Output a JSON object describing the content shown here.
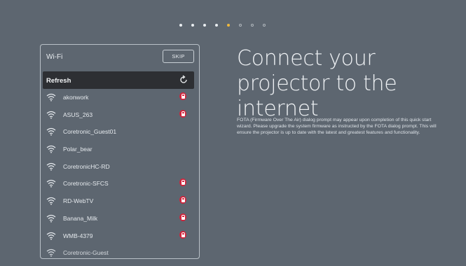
{
  "progress": {
    "total_steps": 8,
    "current_step": 5
  },
  "colors": {
    "background": "#5d6670",
    "active_step": "#f0b83b",
    "lock": "#d0243c",
    "refresh_bar": "#2d2f33"
  },
  "wifi_panel": {
    "title": "Wi-Fi",
    "skip_label": "SKIP",
    "refresh_label": "Refresh",
    "refresh_icon": "refresh-icon",
    "networks": [
      {
        "name": "akonwork",
        "secured": true
      },
      {
        "name": "ASUS_263",
        "secured": true
      },
      {
        "name": "Coretronic_Guest01",
        "secured": false
      },
      {
        "name": "Polar_bear",
        "secured": false
      },
      {
        "name": "CoretronicHC-RD",
        "secured": false
      },
      {
        "name": "Coretronic-SFCS",
        "secured": true
      },
      {
        "name": "RD-WebTV",
        "secured": true
      },
      {
        "name": "Banana_Milk",
        "secured": true
      },
      {
        "name": "WMB-4379",
        "secured": true
      },
      {
        "name": "Coretronic-Guest",
        "secured": false
      }
    ]
  },
  "main": {
    "headline": "Connect your projector to the internet",
    "description": "FOTA (Firmware Over The Air) dialog prompt may appear upon completion of this quick start wizard. Please upgrade the system firmware as instructed by the FOTA dialog prompt. This will ensure the projector is up to date with the latest and greatest features and functionality."
  }
}
